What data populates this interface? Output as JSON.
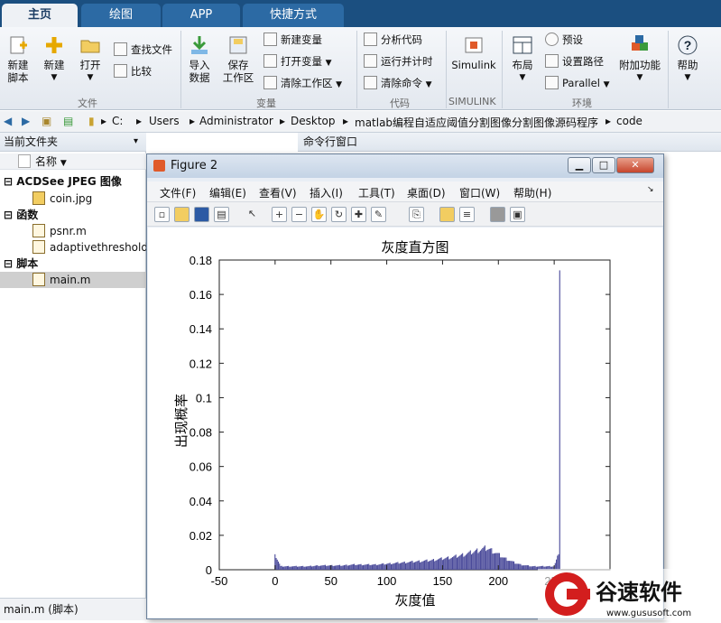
{
  "tabs": [
    {
      "label": "主页",
      "active": true
    },
    {
      "label": "绘图"
    },
    {
      "label": "APP"
    },
    {
      "label": "快捷方式"
    }
  ],
  "ribbon": {
    "new_script": "新建\n脚本",
    "new": "新建",
    "open": "打开",
    "find_files": "查找文件",
    "compare": "比较",
    "import_data": "导入\n数据",
    "save_workspace": "保存\n工作区",
    "new_variable": "新建变量",
    "open_variable": "打开变量",
    "clear_workspace": "清除工作区",
    "analyze_code": "分析代码",
    "run_and_time": "运行并计时",
    "clear_commands": "清除命令",
    "simulink": "Simulink",
    "layout": "布局",
    "preferences": "预设",
    "set_path": "设置路径",
    "parallel": "Parallel",
    "addons": "附加功能",
    "help": "帮助",
    "groups": {
      "file": "文件",
      "variable": "变量",
      "code": "代码",
      "simulink": "SIMULINK",
      "environment": "环境"
    }
  },
  "address": {
    "parts": [
      "C:",
      "Users",
      "Administrator",
      "Desktop",
      "matlab编程自适应阈值分割图像分割图像源码程序",
      "code"
    ]
  },
  "left_panel": {
    "title": "当前文件夹",
    "col_name": "名称",
    "groups": [
      {
        "label": "ACDSee JPEG 图像",
        "items": [
          "coin.jpg"
        ]
      },
      {
        "label": "函数",
        "items": [
          "psnr.m",
          "adaptivethreshold.m"
        ]
      },
      {
        "label": "脚本",
        "items": [
          "main.m"
        ]
      }
    ],
    "selected": "main.m"
  },
  "status": "main.m  (脚本)",
  "cmd_title": "命令行窗口",
  "figure": {
    "title": "Figure 2",
    "menus": [
      "文件(F)",
      "编辑(E)",
      "查看(V)",
      "插入(I)",
      "工具(T)",
      "桌面(D)",
      "窗口(W)",
      "帮助(H)"
    ]
  },
  "chart_data": {
    "type": "bar",
    "title": "灰度直方图",
    "xlabel": "灰度值",
    "ylabel": "出现概率",
    "xlim": [
      -50,
      300
    ],
    "ylim": [
      0,
      0.18
    ],
    "xticks": [
      -50,
      0,
      50,
      100,
      150,
      200,
      250
    ],
    "yticks": [
      0,
      0.02,
      0.04,
      0.06,
      0.08,
      0.1,
      0.12,
      0.14,
      0.16,
      0.18
    ],
    "bar_color": "#4a4a9a",
    "x": [
      0,
      5,
      10,
      20,
      30,
      40,
      50,
      60,
      70,
      80,
      90,
      100,
      110,
      120,
      130,
      140,
      150,
      160,
      170,
      175,
      180,
      185,
      188,
      190,
      192,
      195,
      200,
      205,
      210,
      215,
      220,
      230,
      240,
      250,
      254,
      255
    ],
    "y": [
      0.009,
      0.002,
      0.002,
      0.002,
      0.002,
      0.0025,
      0.0025,
      0.0025,
      0.003,
      0.003,
      0.003,
      0.0035,
      0.004,
      0.0045,
      0.005,
      0.0055,
      0.0065,
      0.0075,
      0.009,
      0.01,
      0.011,
      0.012,
      0.0125,
      0.0125,
      0.012,
      0.011,
      0.009,
      0.007,
      0.0055,
      0.004,
      0.003,
      0.002,
      0.002,
      0.002,
      0.009,
      0.174
    ]
  },
  "watermark": {
    "brand": "谷速软件",
    "url": "www.gususoft.com"
  }
}
